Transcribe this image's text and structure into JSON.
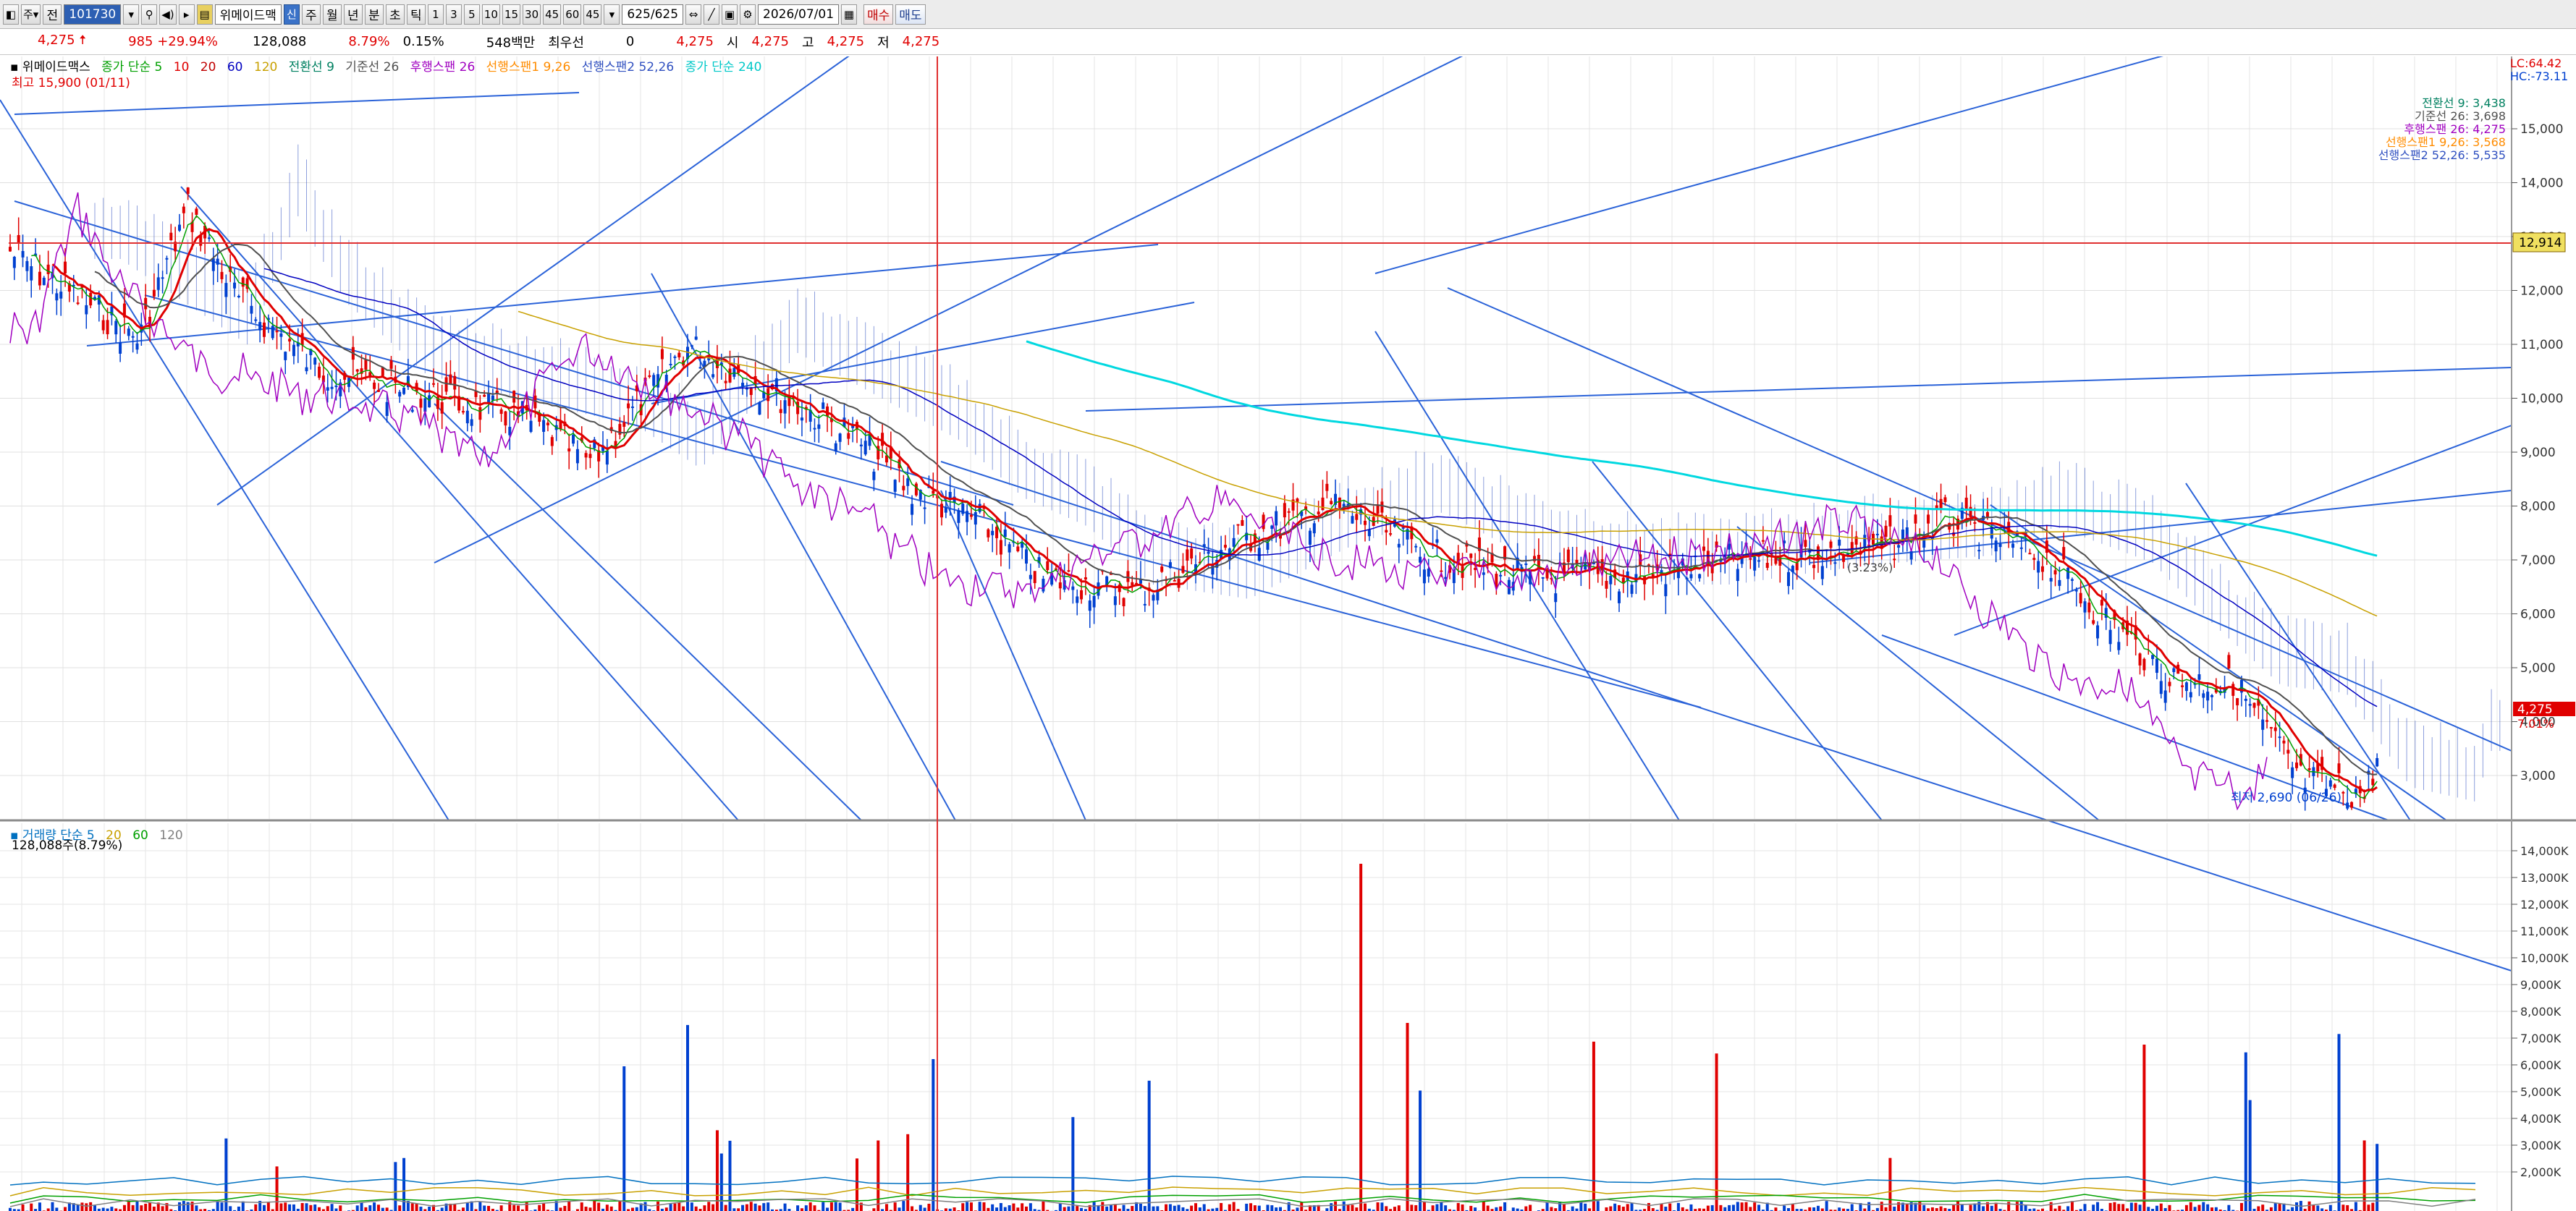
{
  "toolbar": {
    "range_dropdown": "전",
    "code": "101730",
    "stock_name": "위메이드맥",
    "badge_blue": "신",
    "periods": [
      "주",
      "월",
      "년",
      "분",
      "초",
      "틱"
    ],
    "intervals": [
      "1",
      "3",
      "5",
      "10",
      "15",
      "30",
      "45",
      "60",
      "45"
    ],
    "count": "625/625",
    "date": "2026/07/01",
    "buy_label": "매수",
    "sell_label": "매도"
  },
  "quote": {
    "price": "4,275",
    "change": "985",
    "change_pct": "+29.94%",
    "volume": "128,088",
    "turnover_pct": "8.79%",
    "ratio": "0.15%",
    "amount": "548백만",
    "priority_label": "최우선",
    "priority_val": "0",
    "open_price": "4,275",
    "open_label": "시",
    "open_val": "4,275",
    "high_label": "고",
    "high_val": "4,275",
    "low_label": "저",
    "low_val": "4,275"
  },
  "price_panel": {
    "legend": [
      {
        "text": "위메이드맥스",
        "color": "#000000"
      },
      {
        "text": "종가 단순 5",
        "color": "#00a000"
      },
      {
        "text": "10",
        "color": "#e00000"
      },
      {
        "text": "20",
        "color": "#c00000"
      },
      {
        "text": "60",
        "color": "#0000c0"
      },
      {
        "text": "120",
        "color": "#c8a000"
      },
      {
        "text": "전환선 9",
        "color": "#008060"
      },
      {
        "text": "기준선 26",
        "color": "#505050"
      },
      {
        "text": "후행스팬 26",
        "color": "#a000c0"
      },
      {
        "text": "선행스팬1 9,26",
        "color": "#ff8c00"
      },
      {
        "text": "선행스팬2 52,26",
        "color": "#3050c0"
      },
      {
        "text": "종가 단순 240",
        "color": "#00c8c8"
      }
    ],
    "high_label": "최고 15,900 (01/11)",
    "low_label": "최저 2,690 (06/26)",
    "top_right": [
      "LC:64.42",
      "HC:-73.11"
    ],
    "indicator_values": [
      {
        "text": "전환선 9: 3,438",
        "color": "#008060"
      },
      {
        "text": "기준선 26: 3,698",
        "color": "#505050"
      },
      {
        "text": "후행스팬 26: 4,275",
        "color": "#a000c0"
      },
      {
        "text": "선행스팬1 9,26: 3,568",
        "color": "#ff8c00"
      },
      {
        "text": "선행스팬2 52,26: 5,535",
        "color": "#3050c0"
      }
    ],
    "y_ticks": [
      "15,000",
      "14,000",
      "13,000",
      "12,000",
      "11,000",
      "10,000",
      "9,000",
      "8,000",
      "7,000",
      "6,000",
      "5,000",
      "4,000",
      "3,000"
    ],
    "ref_price": "12,914",
    "current_price": "4,275",
    "current_pct": "7.01%",
    "annotation": "(3.23%)"
  },
  "volume_panel": {
    "legend": [
      {
        "text": "거래량 단순 5",
        "color": "#0070c0"
      },
      {
        "text": "20",
        "color": "#c8a000"
      },
      {
        "text": "60",
        "color": "#00a000"
      },
      {
        "text": "120",
        "color": "#808080"
      }
    ],
    "current_label": "128,088주(8.79%)",
    "y_ticks": [
      "14,000K",
      "13,000K",
      "12,000K",
      "11,000K",
      "10,000K",
      "9,000K",
      "8,000K",
      "7,000K",
      "6,000K",
      "5,000K",
      "4,000K",
      "3,000K",
      "2,000K"
    ]
  },
  "colors": {
    "up": "#e00000",
    "down": "#0040d0",
    "cloud": "#3050c0",
    "ma240": "#00d8e0",
    "trend": "#2a62d8"
  }
}
